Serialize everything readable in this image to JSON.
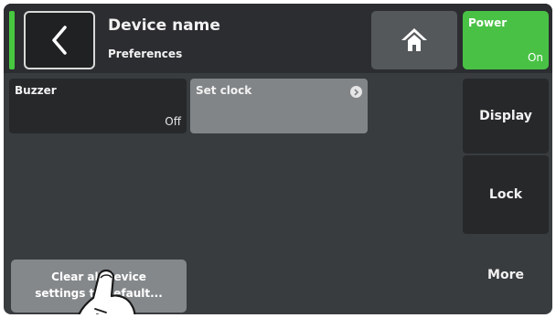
{
  "header": {
    "title": "Device name",
    "subtitle": "Preferences"
  },
  "power": {
    "label": "Power",
    "value": "On"
  },
  "tiles": {
    "buzzer": {
      "label": "Buzzer",
      "value": "Off"
    },
    "set_clock": {
      "label": "Set clock"
    }
  },
  "side": {
    "display": "Display",
    "lock": "Lock",
    "more": "More"
  },
  "actions": {
    "clear_line1": "Clear all device",
    "clear_line2": "settings to default..."
  },
  "colors": {
    "status_green": "#48c840",
    "power_green": "#49c145",
    "background": "#393c3f"
  },
  "icons": {
    "back": "back-chevron-icon",
    "home": "home-icon",
    "set_clock": "arrow-right-circle-icon",
    "pointer": "hand-pointer-icon"
  }
}
